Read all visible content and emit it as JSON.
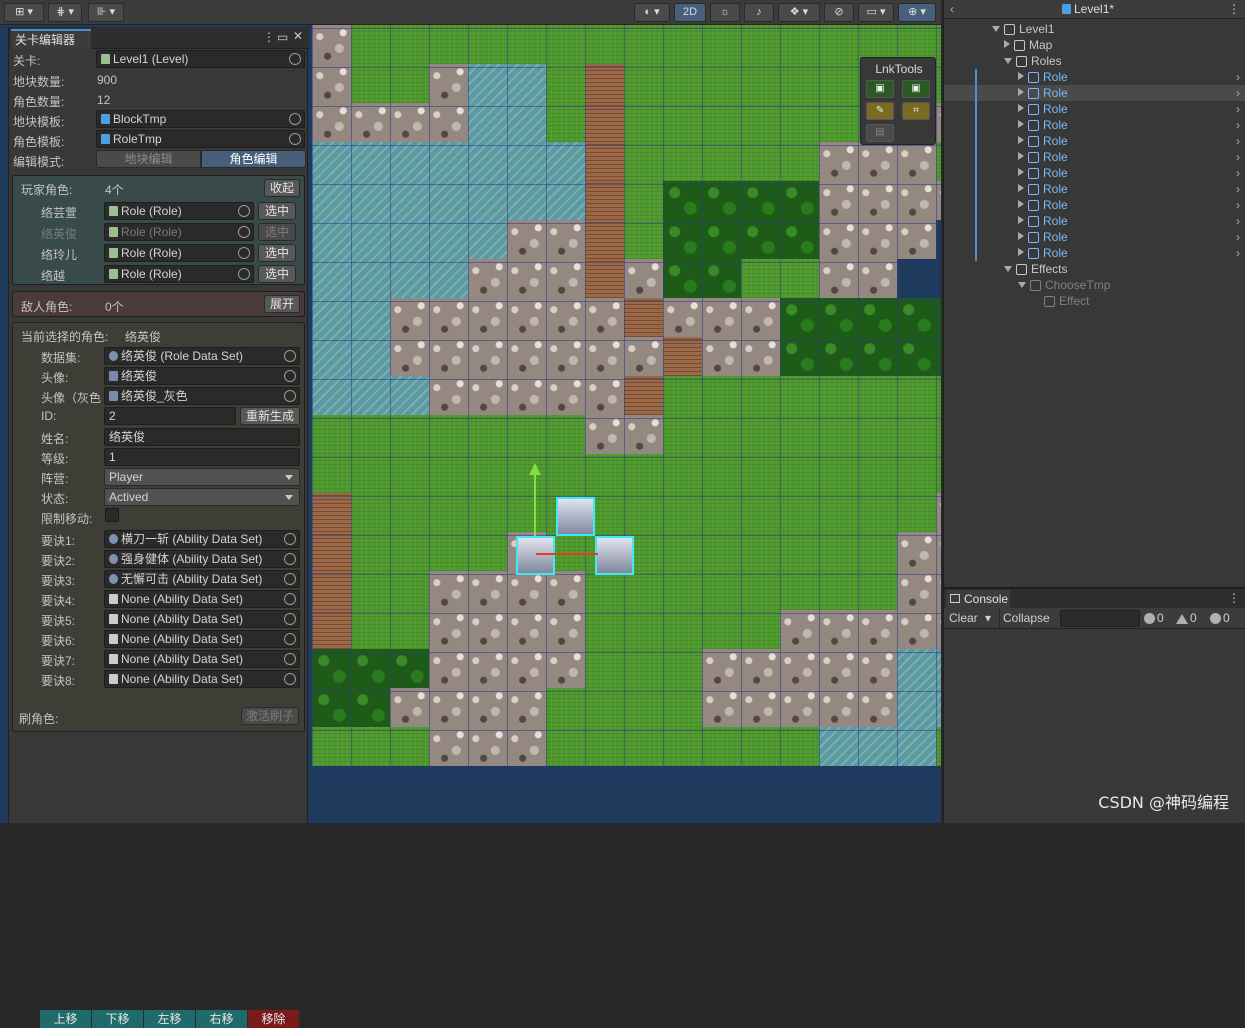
{
  "scene_toolbar": {
    "btn_2d": "2D"
  },
  "lnk_tools": {
    "title": "LnkTools"
  },
  "level_editor": {
    "tab_title": "关卡编辑器",
    "level_label": "关卡:",
    "level_value": "Level1 (Level)",
    "block_count_label": "地块数量:",
    "block_count": "900",
    "role_count_label": "角色数量:",
    "role_count": "12",
    "block_tmp_label": "地块模板:",
    "block_tmp_value": "BlockTmp",
    "role_tmp_label": "角色模板:",
    "role_tmp_value": "RoleTmp",
    "mode_label": "编辑模式:",
    "mode_tile": "地块编辑",
    "mode_role": "角色编辑",
    "players": {
      "title": "玩家角色:",
      "count": "4个",
      "collapse": "收起",
      "select": "选中",
      "rows": [
        {
          "name": "络芸萱",
          "ref": "Role (Role)"
        },
        {
          "name": "络英俊",
          "ref": "Role (Role)"
        },
        {
          "name": "络玲儿",
          "ref": "Role (Role)"
        },
        {
          "name": "络越",
          "ref": "Role (Role)"
        }
      ]
    },
    "enemies": {
      "title": "敌人角色:",
      "count": "0个",
      "expand": "展开"
    },
    "current": {
      "title": "当前选择的角色:",
      "name_value": "络英俊",
      "dataset_label": "数据集:",
      "dataset_value": "络英俊 (Role Data Set)",
      "avatar_label": "头像:",
      "avatar_value": "络英俊",
      "avatar_gray_label": "头像（灰色",
      "avatar_gray_value": "络英俊_灰色",
      "id_label": "ID:",
      "id_value": "2",
      "regen": "重新生成",
      "name_label": "姓名:",
      "name_field": "络英俊",
      "level_label": "等级:",
      "level_value": "1",
      "camp_label": "阵营:",
      "camp_value": "Player",
      "state_label": "状态:",
      "state_value": "Actived",
      "limit_label": "限制移动:",
      "skills": [
        {
          "label": "要诀1:",
          "value": "横刀一斩 (Ability Data Set)"
        },
        {
          "label": "要诀2:",
          "value": "强身健体 (Ability Data Set)"
        },
        {
          "label": "要诀3:",
          "value": "无懈可击 (Ability Data Set)"
        },
        {
          "label": "要诀4:",
          "value": "None (Ability Data Set)"
        },
        {
          "label": "要诀5:",
          "value": "None (Ability Data Set)"
        },
        {
          "label": "要诀6:",
          "value": "None (Ability Data Set)"
        },
        {
          "label": "要诀7:",
          "value": "None (Ability Data Set)"
        },
        {
          "label": "要诀8:",
          "value": "None (Ability Data Set)"
        }
      ],
      "move_up": "上移",
      "move_down": "下移",
      "move_left": "左移",
      "move_right": "右移",
      "remove": "移除"
    },
    "brush_label": "刷角色:",
    "brush_btn": "激活刷子"
  },
  "hierarchy": {
    "title": "Level1*",
    "root": "Level1",
    "map": "Map",
    "roles": "Roles",
    "role_items": [
      "Role",
      "Role",
      "Role",
      "Role",
      "Role",
      "Role",
      "Role",
      "Role",
      "Role",
      "Role",
      "Role",
      "Role"
    ],
    "effects": "Effects",
    "choose_tmp": "ChooseTmp",
    "effect": "Effect"
  },
  "console": {
    "tab": "Console",
    "clear": "Clear",
    "collapse": "Collapse",
    "log_count": "0",
    "warn_count": "0",
    "error_count": "0"
  },
  "watermark": "CSDN @神码编程",
  "map_tiles": [
    "sgggggggggggggggg",
    "sggswwgbggggggggg",
    "sssswwgbgggggggsss",
    "wwwwwwwbgggggsssg",
    "wwwwwwwbgffffssss",
    "wwwwwssbgffffsss",
    "wwwwsssbsffggss",
    "wwssssssbsssfffff",
    "wwsssssssbssffffff",
    "wwwsssssbgggggggg",
    "gggggggssgggggggg",
    "ggggggggggggggggg",
    "bgggggggggggggggs",
    "bggggsgggggggggss",
    "bggssssggggggggss",
    "bggssssgggggssssss",
    "fffssssgggsssssww",
    "ffssssggggsssssww",
    "gggsssgggggggwwwg"
  ]
}
